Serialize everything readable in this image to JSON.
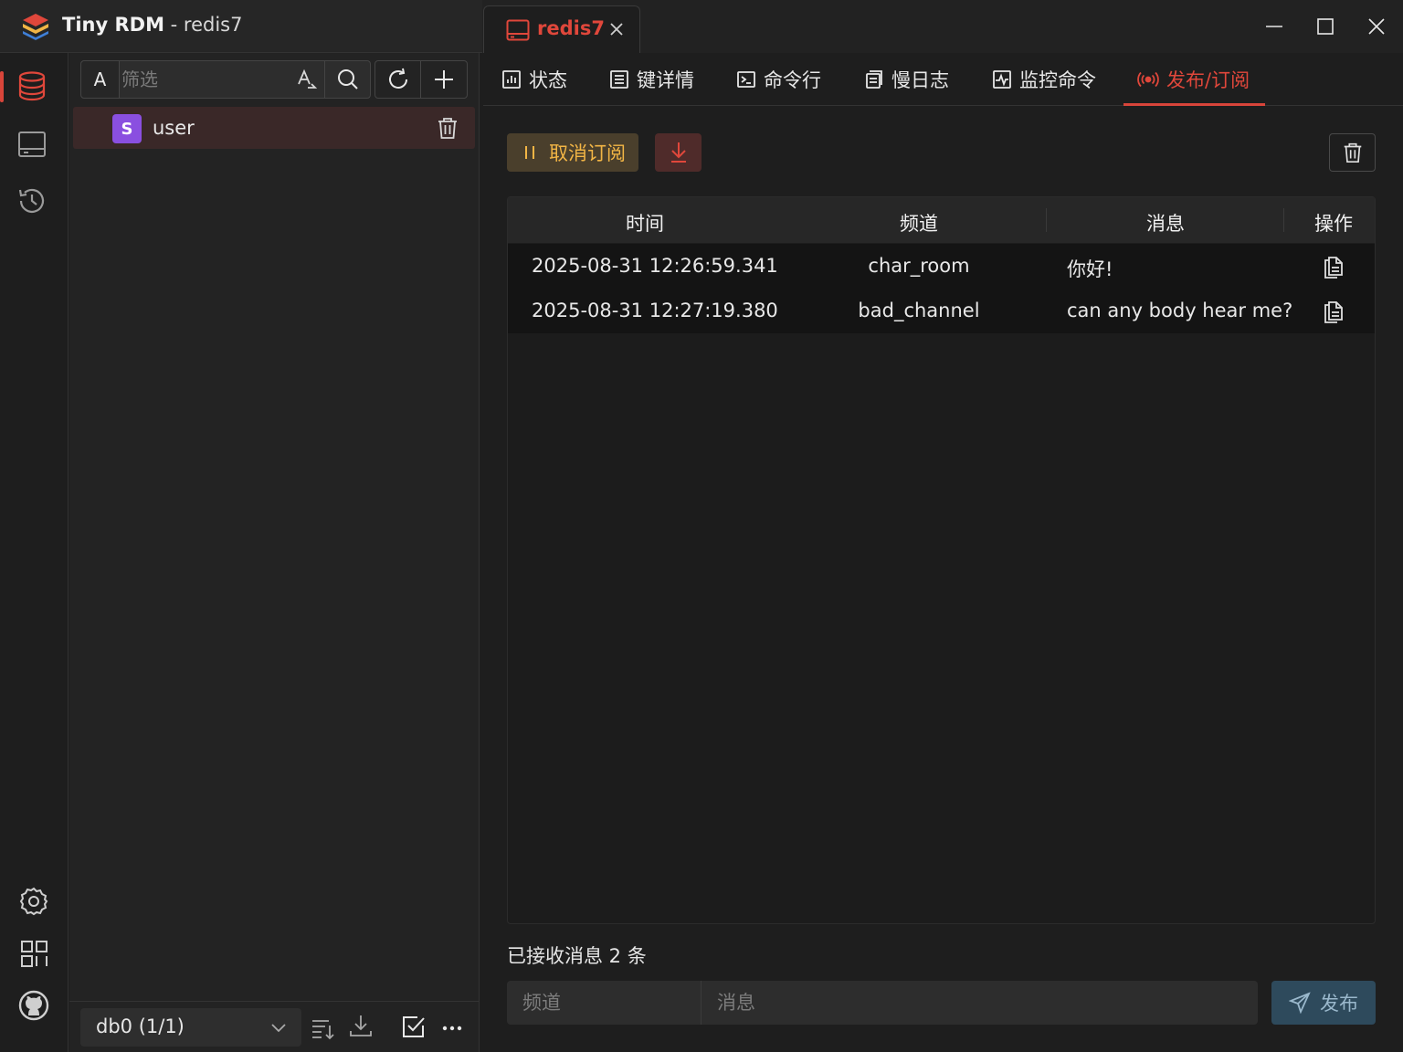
{
  "app": {
    "name": "Tiny RDM",
    "separator": " - ",
    "connection": "redis7"
  },
  "conn_tab": {
    "label": "redis7"
  },
  "filter": {
    "type_label": "A",
    "placeholder": "筛选"
  },
  "keys": [
    {
      "type_badge": "S",
      "name": "user"
    }
  ],
  "db_select": {
    "label": "db0 (1/1)"
  },
  "content_tabs": [
    {
      "label": "状态",
      "icon": "status-icon"
    },
    {
      "label": "键详情",
      "icon": "key-detail-icon"
    },
    {
      "label": "命令行",
      "icon": "terminal-icon"
    },
    {
      "label": "慢日志",
      "icon": "slow-log-icon"
    },
    {
      "label": "监控命令",
      "icon": "monitor-icon"
    },
    {
      "label": "发布/订阅",
      "icon": "broadcast-icon",
      "active": true
    }
  ],
  "toolbar": {
    "unsubscribe_label": "取消订阅"
  },
  "table": {
    "headers": [
      "时间",
      "频道",
      "消息",
      "操作"
    ],
    "rows": [
      {
        "time": "2025-08-31 12:26:59.341",
        "channel": "char_room",
        "message": "你好!"
      },
      {
        "time": "2025-08-31 12:27:19.380",
        "channel": "bad_channel",
        "message": "can any body hear me?"
      }
    ]
  },
  "status": {
    "received": "已接收消息 2 条"
  },
  "publish": {
    "channel_placeholder": "频道",
    "message_placeholder": "消息",
    "button_label": "发布"
  },
  "colors": {
    "accent": "#d8453a",
    "warning": "#f2b545",
    "type_string": "#8a4fe0",
    "publish": "#2e4a5c"
  }
}
